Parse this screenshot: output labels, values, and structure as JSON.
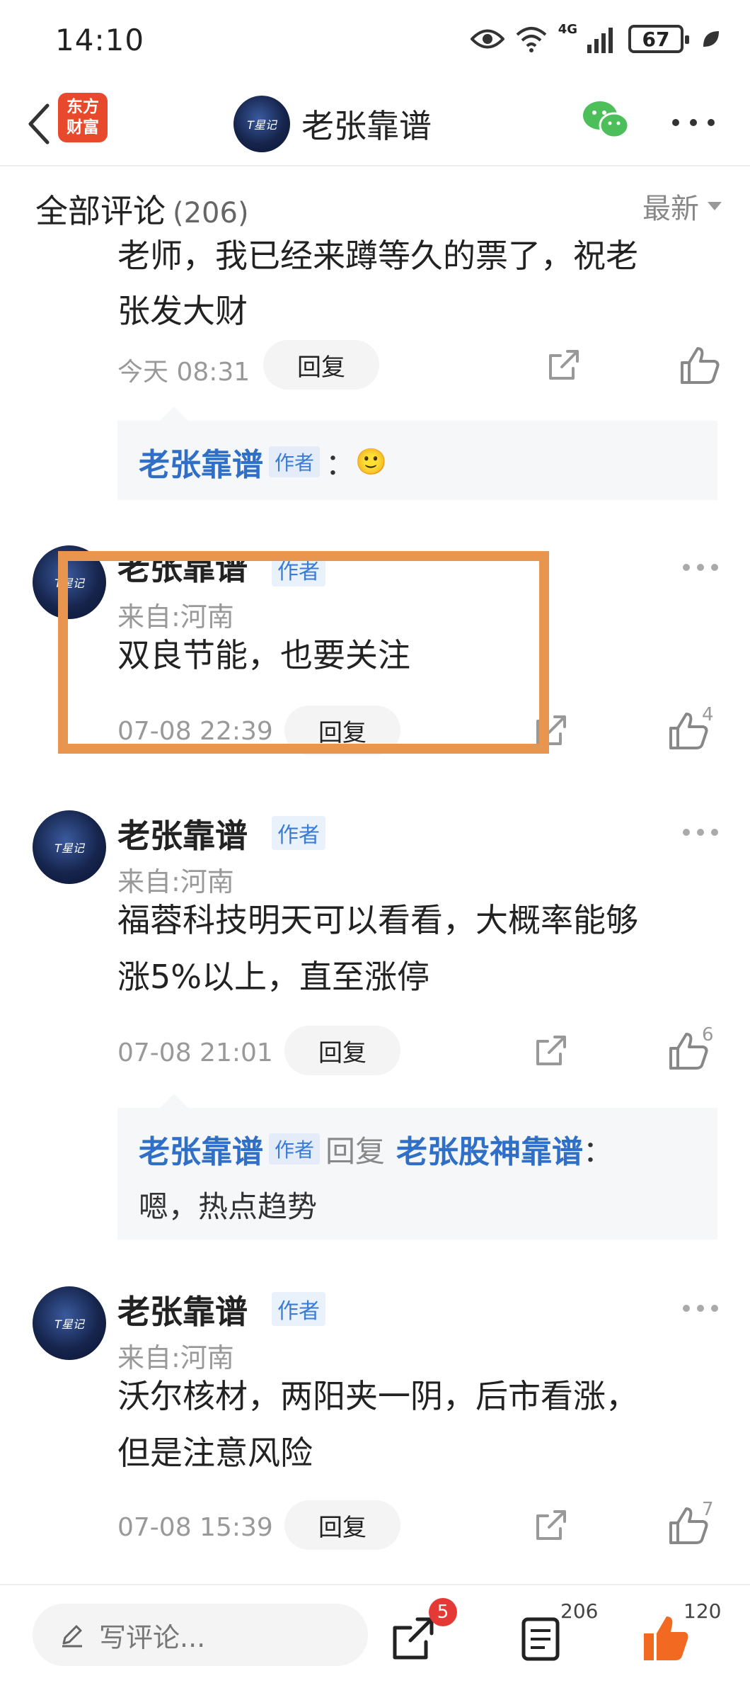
{
  "status": {
    "time": "14:10",
    "battery": "67",
    "network": "4G"
  },
  "nav": {
    "logo_line1": "东方",
    "logo_line2": "财富",
    "title": "老张靠谱",
    "avatar_text": "T星记"
  },
  "header": {
    "title": "全部评论",
    "count": "(206)",
    "sort": "最新"
  },
  "comments": [
    {
      "text_line1": "老师，我已经来蹲等久的票了，祝老",
      "text_line2": "张发大财",
      "time": "今天 08:31",
      "reply_label": "回复",
      "reply": {
        "name": "老张靠谱",
        "tag": "作者",
        "colon": "：",
        "emoji": "🙂"
      }
    },
    {
      "avatar_text": "T星记",
      "name": "老张靠谱",
      "tag": "作者",
      "location": "来自:河南",
      "text": "双良节能，也要关注",
      "time": "07-08 22:39",
      "reply_label": "回复",
      "likes": "4"
    },
    {
      "avatar_text": "T星记",
      "name": "老张靠谱",
      "tag": "作者",
      "location": "来自:河南",
      "text_line1": "福蓉科技明天可以看看，大概率能够",
      "text_line2": "涨5%以上，直至涨停",
      "time": "07-08 21:01",
      "reply_label": "回复",
      "likes": "6",
      "reply": {
        "name": "老张靠谱",
        "tag": "作者",
        "mid": "回复",
        "target": "老张股神靠谱",
        "colon": "：",
        "text": "嗯，热点趋势"
      }
    },
    {
      "avatar_text": "T星记",
      "name": "老张靠谱",
      "tag": "作者",
      "location": "来自:河南",
      "text_line1": "沃尔核材，两阳夹一阴，后市看涨，",
      "text_line2": "但是注意风险",
      "time": "07-08 15:39",
      "reply_label": "回复",
      "likes": "7"
    }
  ],
  "bottom": {
    "placeholder": "写评论...",
    "share_badge": "5",
    "comment_count": "206",
    "like_count": "120"
  },
  "colors": {
    "accent_blue": "#2f6fc7",
    "highlight": "#e89550",
    "logo_red": "#e8482c",
    "like_orange": "#f26a21"
  }
}
